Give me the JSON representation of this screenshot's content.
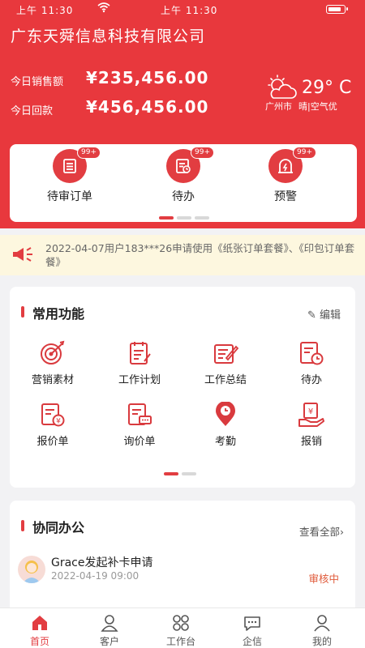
{
  "status_bar": {
    "left_time": "上午 11:30",
    "center_time": "上午 11:30",
    "battery_level": 0.85
  },
  "header": {
    "company": "广东天舜信息科技有限公司",
    "sales_label": "今日销售额",
    "sales_value": "¥235,456.00",
    "collection_label": "今日回款",
    "collection_value": "¥456,456.00"
  },
  "weather": {
    "temperature": "29° C",
    "city": "广州市",
    "condition": "晴|空气优",
    "icon": "partly-cloudy-icon"
  },
  "quick_actions": [
    {
      "label": "待审订单",
      "badge": "99+",
      "icon": "order-review-icon"
    },
    {
      "label": "待办",
      "badge": "99+",
      "icon": "todo-icon"
    },
    {
      "label": "预警",
      "badge": "99+",
      "icon": "warning-icon"
    }
  ],
  "quick_pager": {
    "pages": 3,
    "active": 0
  },
  "notice": {
    "text": "2022-04-07用户183***26申请使用《纸张订单套餐》、《印包订单套餐》",
    "icon": "megaphone-icon"
  },
  "functions": {
    "title": "常用功能",
    "edit_label": "编辑",
    "items": [
      {
        "label": "营销素材",
        "icon": "target-icon"
      },
      {
        "label": "工作计划",
        "icon": "plan-icon"
      },
      {
        "label": "工作总结",
        "icon": "summary-icon"
      },
      {
        "label": "待办",
        "icon": "todo-clock-icon"
      },
      {
        "label": "报价单",
        "icon": "quote-icon"
      },
      {
        "label": "询价单",
        "icon": "inquiry-icon"
      },
      {
        "label": "考勤",
        "icon": "location-clock-icon"
      },
      {
        "label": "报销",
        "icon": "reimburse-icon"
      }
    ],
    "pager": {
      "pages": 2,
      "active": 0
    }
  },
  "collab": {
    "title": "协同办公",
    "view_all": "查看全部",
    "item": {
      "title": "Grace发起补卡申请",
      "time": "2022-04-19 09:00",
      "status": "审核中"
    }
  },
  "tabs": [
    {
      "label": "首页",
      "icon": "home-icon",
      "active": true
    },
    {
      "label": "客户",
      "icon": "customer-icon",
      "active": false
    },
    {
      "label": "工作台",
      "icon": "workbench-icon",
      "active": false
    },
    {
      "label": "企信",
      "icon": "message-icon",
      "active": false
    },
    {
      "label": "我的",
      "icon": "profile-icon",
      "active": false
    }
  ],
  "colors": {
    "brand_red": "#e8383d",
    "accent_red": "#e23d41",
    "notice_bg": "#fdf7df",
    "status_orange": "#e05a3a"
  }
}
